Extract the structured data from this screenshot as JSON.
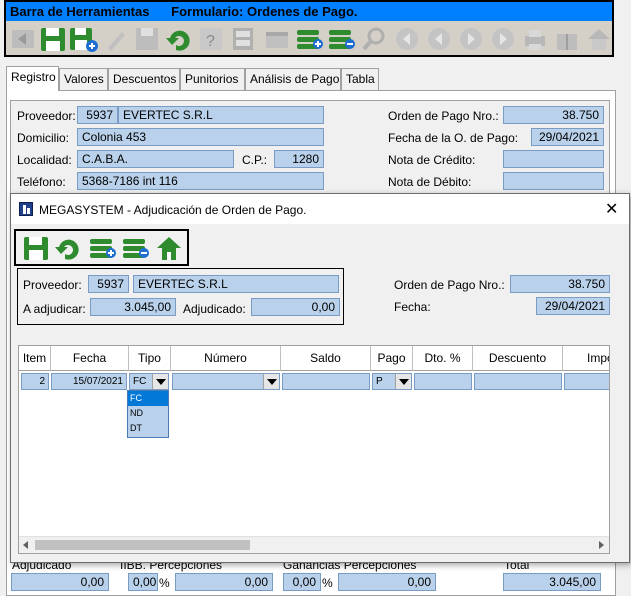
{
  "toolbar": {
    "title": "Barra de Herramientas      Formulario: Ordenes de Pago."
  },
  "tabs": [
    "Registro",
    "Valores",
    "Descuentos",
    "Punitorios",
    "Análisis de Pago",
    "Tabla"
  ],
  "header": {
    "proveedor_label": "Proveedor:",
    "proveedor_code": "5937",
    "proveedor_name": "EVERTEC S.R.L",
    "domicilio_label": "Domicilio:",
    "domicilio": "Colonia 453",
    "localidad_label": "Localidad:",
    "localidad": "C.A.B.A.",
    "cp_label": "C.P.:",
    "cp": "1280",
    "telefono_label": "Teléfono:",
    "telefono": "5368-7186   int 116",
    "orden_label": "Orden de Pago Nro.:",
    "orden": "38.750",
    "fecha_label": "Fecha de la O. de Pago:",
    "fecha": "29/04/2021",
    "nota_credito_label": "Nota de Crédito:",
    "nota_debito_label": "Nota de Débito:"
  },
  "dialog": {
    "title": "MEGASYSTEM - Adjudicación de Orden de Pago.",
    "close": "✕",
    "proveedor_label": "Proveedor:",
    "proveedor_code": "5937",
    "proveedor_name": "EVERTEC S.R.L",
    "adjudicar_label": "A adjudicar:",
    "adjudicar": "3.045,00",
    "adjudicado_label": "Adjudicado:",
    "adjudicado": "0,00",
    "orden_label": "Orden de Pago Nro.:",
    "orden": "38.750",
    "fecha_label": "Fecha:",
    "fecha": "29/04/2021",
    "grid": {
      "headers": [
        "Item",
        "Fecha",
        "Tipo",
        "Número",
        "Saldo",
        "Pago",
        "Dto. %",
        "Descuento",
        "Impo"
      ],
      "row": {
        "item": "2",
        "fecha": "15/07/2021",
        "tipo": "FC",
        "numero": "",
        "saldo": "",
        "pago": "P",
        "dto": "",
        "descuento": "",
        "importe": ""
      },
      "tipo_options": [
        "FC",
        "ND",
        "DT"
      ]
    }
  },
  "footer": {
    "adjudicado_label": "Adjudicado",
    "iibb_label": "IIBB. Percepciones",
    "ganancias_label": "Ganancias Percepciones",
    "total_label": "Total",
    "adjudicado": "0,00",
    "iibb_pct": "0,00",
    "iibb": "0,00",
    "ganancias_pct": "0,00",
    "ganancias": "0,00",
    "total": "3.045,00",
    "pct_sign": "%",
    "ellipsis": "..."
  },
  "colors": {
    "field_bg": "#b9d1ea",
    "title_bar": "#0080ff",
    "icon_green": "#2e8b2e",
    "selection": "#0078d7"
  }
}
